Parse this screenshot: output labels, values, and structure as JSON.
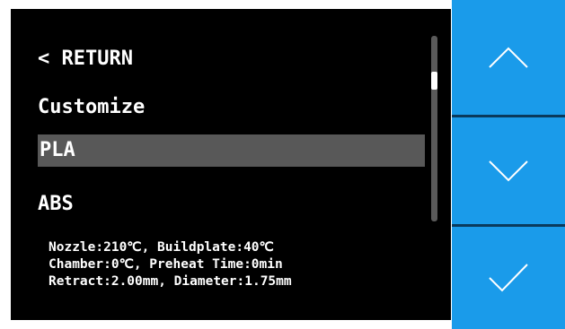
{
  "menu": {
    "return_label": "< RETURN",
    "items": [
      {
        "label": "Customize",
        "selected": false
      },
      {
        "label": "PLA",
        "selected": true
      },
      {
        "label": "ABS",
        "selected": false
      }
    ]
  },
  "info": {
    "line1": "Nozzle:210℃, Buildplate:40℃",
    "line2": "Chamber:0℃, Preheat Time:0min",
    "line3": "Retract:2.00mm, Diameter:1.75mm"
  },
  "buttons": {
    "up_icon": "chevron-up-icon",
    "down_icon": "chevron-down-icon",
    "confirm_icon": "checkmark-icon"
  },
  "colors": {
    "screen_bg": "#000000",
    "selected_bg": "#585858",
    "button_bg": "#1a9bea",
    "text": "#ffffff"
  }
}
